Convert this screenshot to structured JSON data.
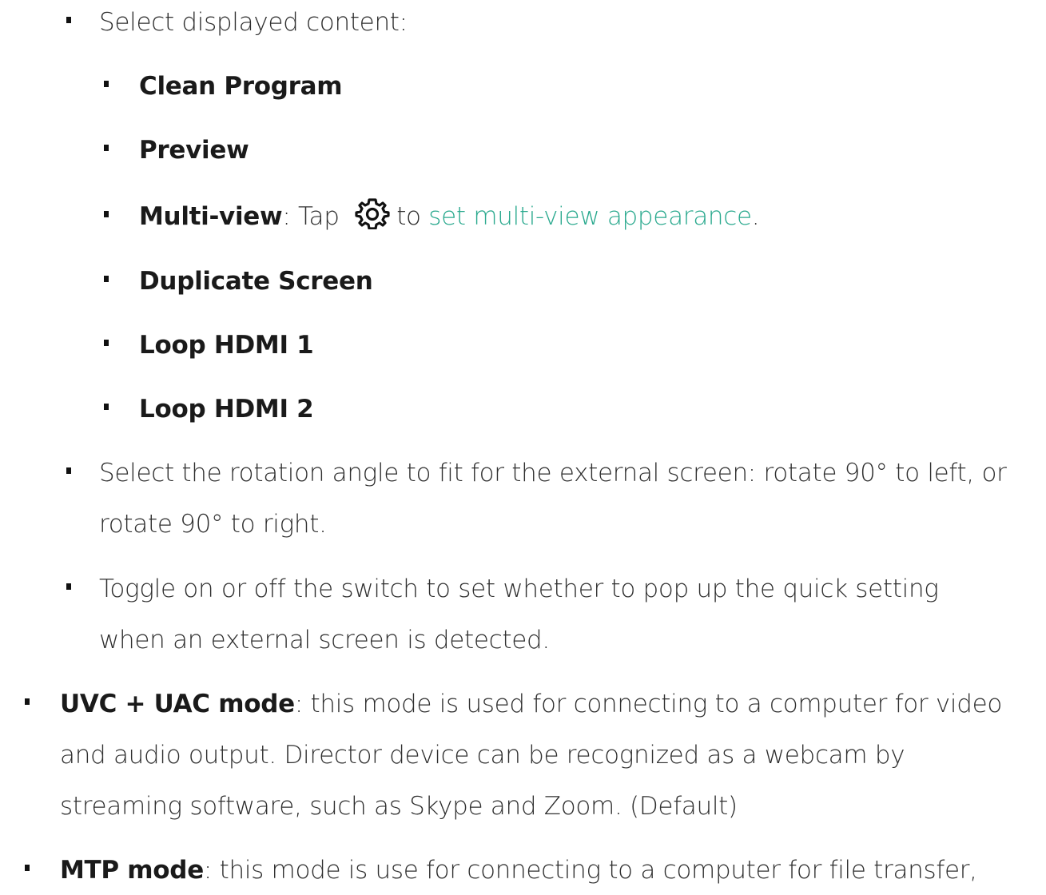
{
  "items": {
    "select_content": "Select displayed content:",
    "clean_program": "Clean Program",
    "preview": "Preview",
    "multiview_label": "Multi-view",
    "multiview_after_label": ": Tap",
    "multiview_to": "to",
    "multiview_link": "set multi-view appearance",
    "multiview_end": ".",
    "duplicate_screen": "Duplicate Screen",
    "loop_hdmi_1": "Loop HDMI 1",
    "loop_hdmi_2": "Loop HDMI 2",
    "rotation_line1": "Select the rotation angle to fit for the external screen: rotate 90° to left, or",
    "rotation_line2": "rotate 90° to right.",
    "toggle_line1": "Toggle on or off the switch to set whether to pop up the quick setting",
    "toggle_line2": "when an external screen is detected.",
    "uvc_label": "UVC + UAC mode",
    "uvc_line1_rest": ": this mode is used for connecting to a computer for video",
    "uvc_line2": "and audio output. Director device can be recognized as a webcam by",
    "uvc_line3": "streaming software, such as Skype and Zoom. (Default)",
    "mtp_label": "MTP mode",
    "mtp_line1_rest": ": this mode is use for connecting to a computer for file transfer,"
  },
  "icons": {
    "settings": "gear-icon"
  },
  "colors": {
    "link": "#2aa98e",
    "text": "#2f2f2f",
    "bullet": "#111111"
  }
}
